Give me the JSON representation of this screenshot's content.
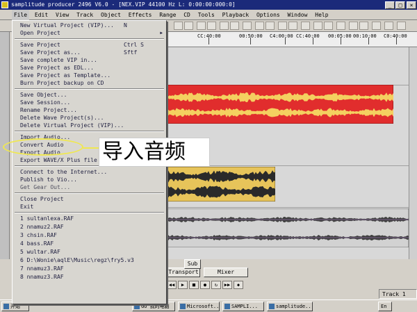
{
  "window": {
    "title": "samplitude producer 2496 V6.0 - [NEX.VIP  44100 Hz L: 0:00:00:000:0]",
    "controls": [
      "_",
      "□",
      "×"
    ]
  },
  "menubar": [
    "File",
    "Edit",
    "View",
    "Track",
    "Object",
    "Effects",
    "Range",
    "CD",
    "Tools",
    "Playback",
    "Options",
    "Window",
    "Help"
  ],
  "ruler": {
    "labels": [
      "CC:40:00",
      "00:50:00",
      "C4:00:00",
      "CC:40:00",
      "00:05:00",
      "00:10:00",
      "C0:40:00"
    ]
  },
  "file_menu": {
    "items": [
      {
        "label": "New Virtual Project (VIP)...",
        "shortcut": "N"
      },
      {
        "label": "Open Project",
        "submenu": true
      },
      {
        "separator": true
      },
      {
        "label": "Save Project",
        "shortcut": "Ctrl S"
      },
      {
        "label": "Save Project as...",
        "shortcut": "Sftf"
      },
      {
        "label": "Save complete VIP in..."
      },
      {
        "label": "Save Project as EDL..."
      },
      {
        "label": "Save Project as Template..."
      },
      {
        "label": "Burn Project backup on CD"
      },
      {
        "separator": true
      },
      {
        "label": "Save Object..."
      },
      {
        "label": "Save Session..."
      },
      {
        "label": "Rename Project..."
      },
      {
        "label": "Delete Wave Project(s)..."
      },
      {
        "label": "Delete Virtual Project (VIP)..."
      },
      {
        "separator": true
      },
      {
        "label": "Import Audio..."
      },
      {
        "label": "Convert Audio"
      },
      {
        "label": "Export Audio"
      },
      {
        "label": "Export WAVE/X Plus file"
      },
      {
        "separator": true
      },
      {
        "label": "Connect to the Internet..."
      },
      {
        "label": "Publish to Vio..."
      },
      {
        "label": "Get Gear Out..."
      },
      {
        "separator": true
      },
      {
        "label": "Close Project"
      },
      {
        "label": "Exit"
      },
      {
        "separator": true
      },
      {
        "label": "1 sultanlexa.RAF"
      },
      {
        "label": "2 nnamuz2.RAF"
      },
      {
        "label": "3 chsin.RAF"
      },
      {
        "label": "4 bass.RAF"
      },
      {
        "label": "5 wultar.RAF"
      },
      {
        "label": "6 D:\\Wonie\\aqlE\\Music\\regz\\fry5.v3"
      },
      {
        "label": "7 nnamuz3.RAF"
      },
      {
        "label": "8 nnamuz3.RAF"
      }
    ]
  },
  "annotation": {
    "text": "导入音频"
  },
  "bottom_panel": {
    "transport_label": "Transport",
    "mixer_label": "Mixer",
    "mid_label": "Sub",
    "status": "Track 1"
  },
  "taskbar": {
    "start_label": "开始",
    "tasks": [
      "GO 我的电脑",
      "Microsoft...",
      "SAMPLI...",
      "samplitude..."
    ],
    "tray_label": "En"
  },
  "colors": {
    "red_clip": "#e12d2d",
    "gold_clip": "#e7c45a",
    "titlebar": "#1b2a7a",
    "highlight": "#f0e850"
  }
}
